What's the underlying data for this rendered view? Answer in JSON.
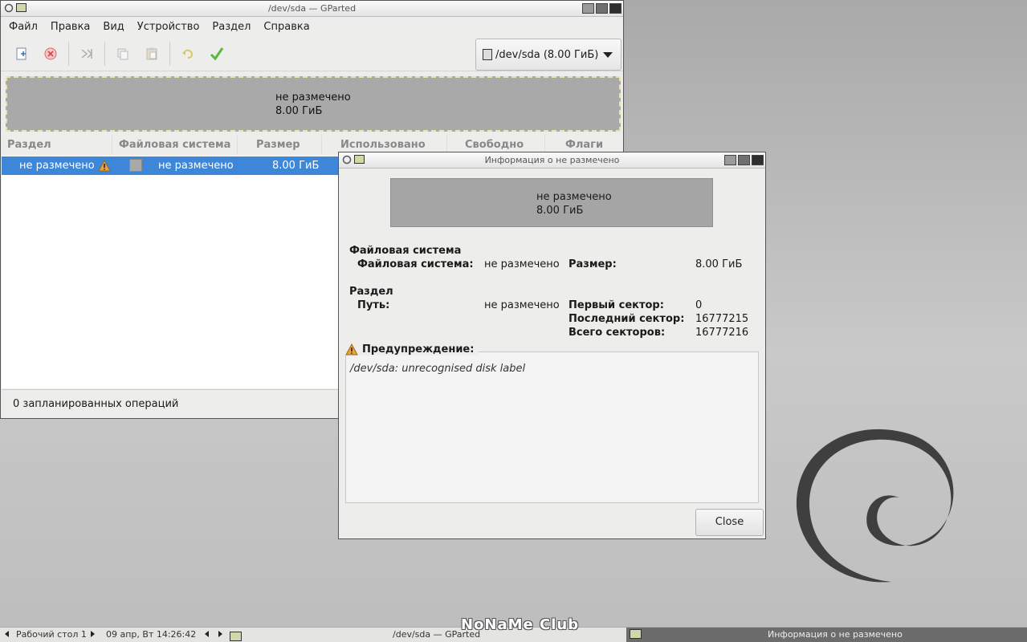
{
  "main_window": {
    "title": "/dev/sda — GParted",
    "menu": [
      "Файл",
      "Правка",
      "Вид",
      "Устройство",
      "Раздел",
      "Справка"
    ],
    "toolbar": {
      "new": "new-partition-icon",
      "delete": "delete-icon",
      "resize": "resize-move-icon",
      "copy": "copy-icon",
      "paste": "paste-icon",
      "undo": "undo-icon",
      "apply": "apply-icon"
    },
    "device_selector": "/dev/sda (8.00 ГиБ)",
    "disk_map": {
      "line1": "не размечено",
      "line2": "8.00 ГиБ"
    },
    "columns": [
      "Раздел",
      "Файловая система",
      "Размер",
      "Использовано",
      "Свободно",
      "Флаги"
    ],
    "rows": [
      {
        "partition": "не размечено",
        "filesystem": "не размечено",
        "size": "8.00 ГиБ",
        "used": "",
        "free": "",
        "flags": ""
      }
    ],
    "status": "0 запланированных операций"
  },
  "info_dialog": {
    "title": "Информация о не размечено",
    "map": {
      "line1": "не размечено",
      "line2": "8.00 ГиБ"
    },
    "fs_section": "Файловая система",
    "fs_label": "Файловая система:",
    "fs_value": "не размечено",
    "size_label": "Размер:",
    "size_value": "8.00 ГиБ",
    "part_section": "Раздел",
    "path_label": "Путь:",
    "path_value": "не размечено",
    "first_sector_label": "Первый сектор:",
    "first_sector_value": "0",
    "last_sector_label": "Последний сектор:",
    "last_sector_value": "16777215",
    "total_sectors_label": "Всего секторов:",
    "total_sectors_value": "16777216",
    "warning_label": "Предупреждение:",
    "warning_text": "/dev/sda: unrecognised disk label",
    "close_label": "Close"
  },
  "taskbar": {
    "desktop": "Рабочий стол 1",
    "datetime": "09 апр, Вт 14:26:42",
    "task1": "/dev/sda — GParted",
    "task2": "Информация о не размечено"
  },
  "watermark": "NoNaMe Club",
  "colors": {
    "selection": "#3d86d8",
    "unallocated": "#a9a9a9",
    "warning": "#e8a33a",
    "apply": "#5cb83a"
  }
}
